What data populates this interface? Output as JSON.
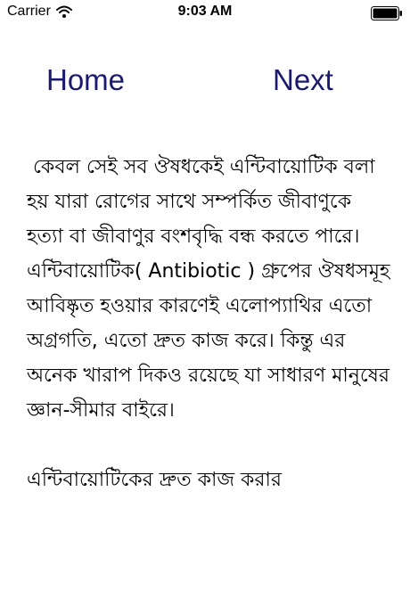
{
  "status_bar": {
    "carrier": "Carrier",
    "time": "9:03 AM",
    "wifi_icon": "wifi-icon",
    "battery_icon": "battery-icon"
  },
  "nav": {
    "home_label": "Home",
    "next_label": "Next"
  },
  "article": {
    "paragraphs": [
      " কেবল সেই সব ঔষধকেই এন্টিবায়োটিক বলা হয় যারা রোগের সাথে সম্পর্কিত জীবাণুকে হত্যা বা জীবাণুর বংশবৃদ্ধি বন্ধ করতে পারে। এন্টিবায়োটিক( Antibiotic ) গ্রুপের ঔষধসমূহ আবিষ্কৃত হওয়ার কারণেই এলোপ্যাথির এতো অগ্রগতি, এতো দ্রুত কাজ করে। কিন্তু এর অনেক খারাপ দিকও রয়েছে যা সাধারণ মানুষের জ্ঞান-সীমার বাইরে।",
      "এন্টিবায়োটিকের দ্রুত কাজ করার"
    ]
  }
}
